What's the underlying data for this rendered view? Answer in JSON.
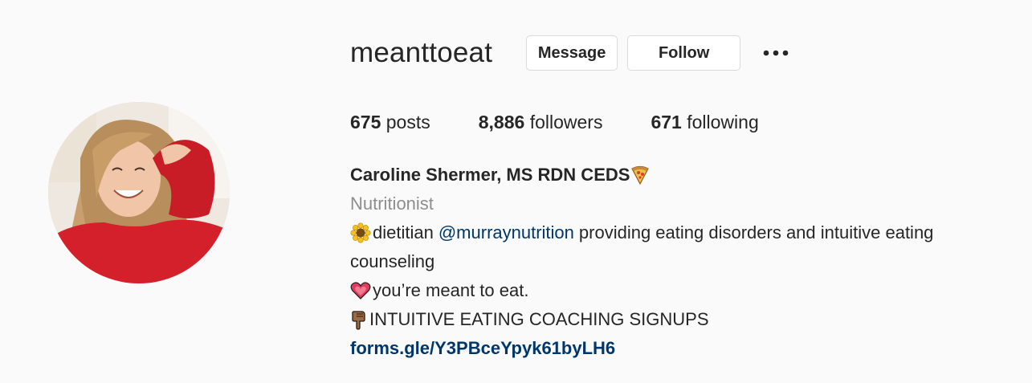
{
  "profile": {
    "username": "meanttoeat",
    "buttons": {
      "message": "Message",
      "follow": "Follow"
    },
    "more_icon": "more-horizontal-icon",
    "stats": {
      "posts_count": "675",
      "posts_label": "posts",
      "followers_count": "8,886",
      "followers_label": "followers",
      "following_count": "671",
      "following_label": "following"
    },
    "full_name": "Caroline Shermer, MS RDN CEDS",
    "category": "Nutritionist",
    "bio": {
      "line1_pre": "dietitian",
      "line1_mention": "@murraynutrition",
      "line1_post": "providing eating disorders and intuitive eating",
      "line2": "counseling",
      "line3": "you’re meant to eat.",
      "line4": "INTUITIVE EATING COACHING SIGNUPS"
    },
    "link": "forms.gle/Y3PBceYpyk61byLH6",
    "icons": {
      "name_emoji": "pizza-icon",
      "line1_emoji": "sunflower-icon",
      "line3_emoji": "heart-icon",
      "line4_emoji": "pointing-down-icon"
    },
    "colors": {
      "background": "#fafafa",
      "text": "#262626",
      "secondary": "#8e8e8e",
      "link": "#00376b",
      "border": "#dbdbdb"
    }
  }
}
